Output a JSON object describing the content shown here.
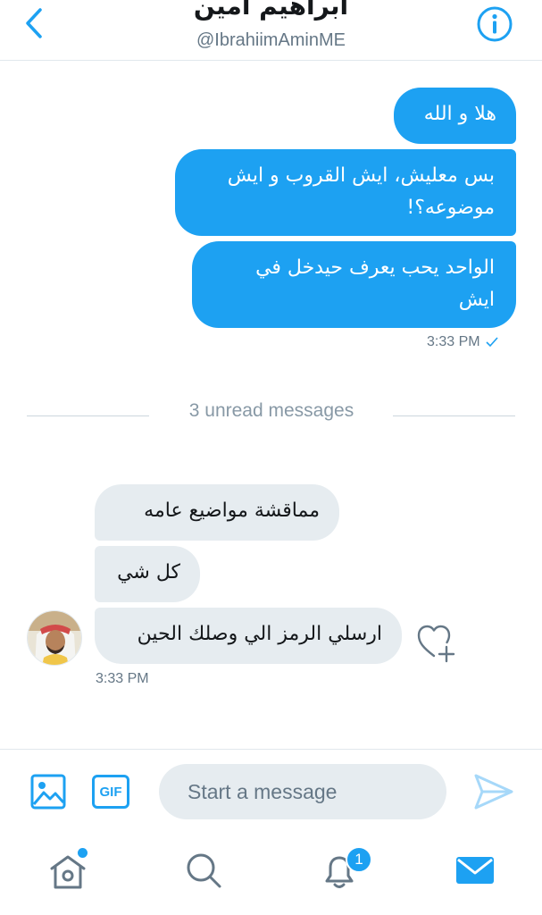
{
  "header": {
    "title": "ابراهيم امين",
    "handle": "@IbrahiimAminME",
    "back_icon": "chevron-left-icon",
    "info_icon": "info-icon"
  },
  "colors": {
    "accent": "#1da1f2",
    "received_bubble": "#e6ecf0",
    "secondary_text": "#657786"
  },
  "conversation": {
    "sent_messages": [
      {
        "text": "هلا و الله"
      },
      {
        "text": "بس معليش، ايش القروب و ايش موضوعه؟!"
      },
      {
        "text": "الواحد يحب يعرف حيدخل في ايش"
      }
    ],
    "sent_time": "3:33 PM",
    "sent_status_icon": "checkmark-icon",
    "unread_divider": "3 unread messages",
    "received_messages": [
      {
        "text": "مماقشة مواضيع عامه"
      },
      {
        "text": "كل شي"
      },
      {
        "text": "ارسلي الرمز الي وصلك الحين"
      }
    ],
    "received_time": "3:33 PM",
    "like_icon": "heart-plus-icon"
  },
  "composer": {
    "media_icon": "image-icon",
    "gif_label": "GIF",
    "placeholder": "Start a message",
    "send_icon": "send-icon"
  },
  "tabbar": {
    "items": [
      {
        "name": "home",
        "icon": "home-icon",
        "has_dot": true
      },
      {
        "name": "search",
        "icon": "search-icon"
      },
      {
        "name": "notifications",
        "icon": "bell-icon",
        "badge": "1"
      },
      {
        "name": "messages",
        "icon": "mail-icon",
        "active": true
      }
    ]
  }
}
